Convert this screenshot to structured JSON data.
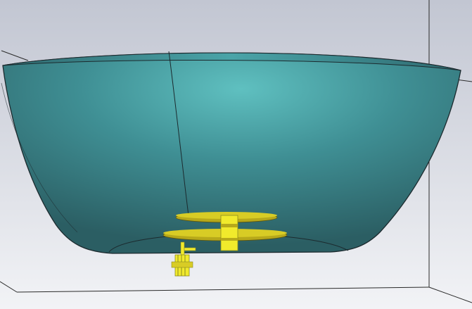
{
  "viewport": {
    "background_top": "#c2c6d2",
    "background_bottom": "#f2f3f6"
  },
  "colors": {
    "reflector_center": "#5fc0c0",
    "reflector_mid": "#3f8f94",
    "reflector_edge": "#2b5e63",
    "reflector_outline": "#1c2a2e",
    "box_lines": "#2a2a2a",
    "feed_yellow": "#f1ea2c",
    "feed_yellow_dark": "#b7a91a",
    "feed_olive": "#8c8a20"
  },
  "icons": {
    "reflector": "parabolic-reflector-icon",
    "feed": "dipole-feed-icon",
    "connector": "sma-connector-icon"
  }
}
